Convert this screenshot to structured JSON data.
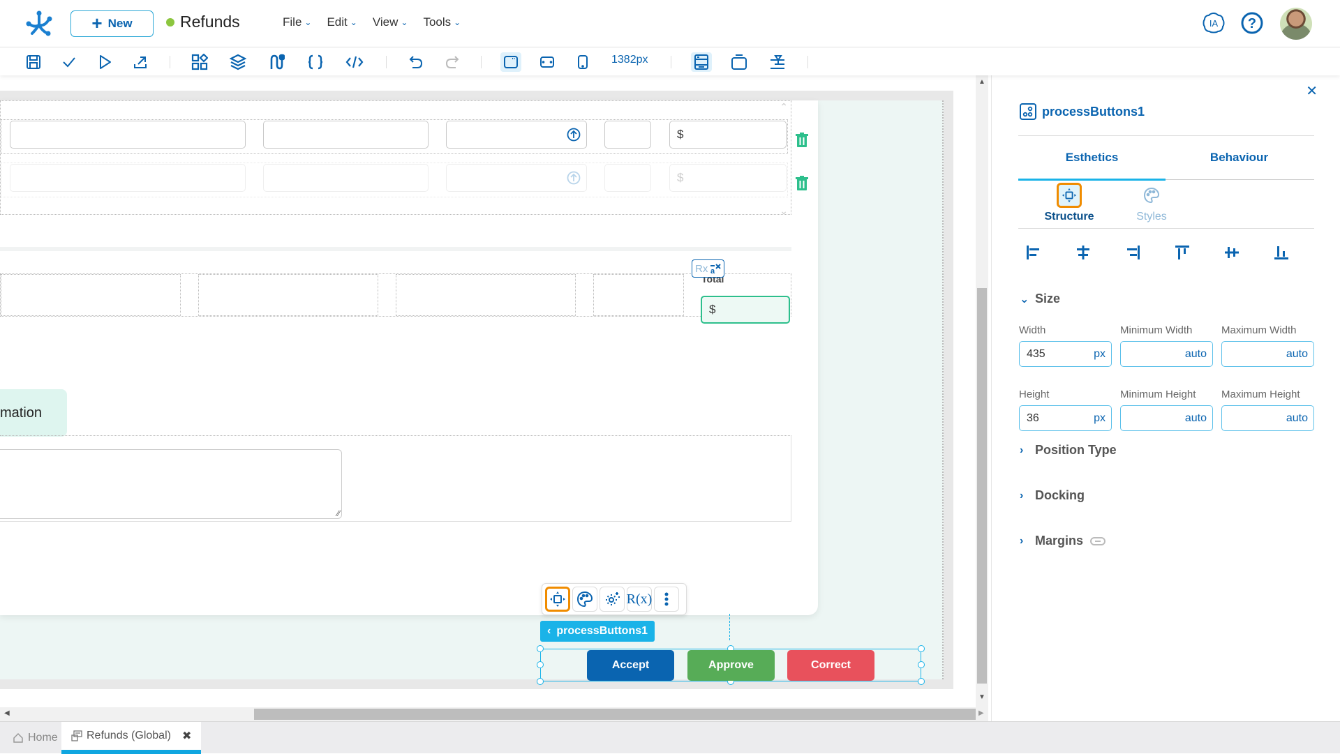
{
  "header": {
    "new_label": "New",
    "app_title": "Refunds",
    "status_color": "#8cc63f",
    "menus": [
      {
        "label": "File"
      },
      {
        "label": "Edit"
      },
      {
        "label": "View"
      },
      {
        "label": "Tools"
      }
    ],
    "ia_label": "IA"
  },
  "toolbar": {
    "icons": [
      "save-icon",
      "check-icon",
      "play-icon",
      "export-icon",
      "components-icon",
      "layers-icon",
      "flows-icon",
      "braces-icon",
      "code-icon",
      "undo-icon",
      "redo-icon",
      "desktop-view-icon",
      "tablet-view-icon",
      "mobile-view-icon",
      "layout-icon",
      "container-icon",
      "dock-icon"
    ],
    "width_readout": "1382px"
  },
  "canvas": {
    "currency_symbol": "$",
    "total_label": "Total",
    "total_value": "$",
    "section_label": "mation",
    "rx_badge": "Rx",
    "floating_toolbar": [
      "structure-icon",
      "palette-icon",
      "settings-icon",
      "rx-icon",
      "more-icon"
    ],
    "rx_glyph": "R(x)",
    "selected_component": "processButtons1",
    "process_buttons": [
      {
        "label": "Accept",
        "color": "#0a64b0"
      },
      {
        "label": "Approve",
        "color": "#57ac57"
      },
      {
        "label": "Correct",
        "color": "#e8515c"
      }
    ]
  },
  "panel": {
    "title": "processButtons1",
    "tabs": [
      {
        "label": "Esthetics"
      },
      {
        "label": "Behaviour"
      }
    ],
    "subtabs": [
      {
        "label": "Structure"
      },
      {
        "label": "Styles"
      }
    ],
    "size_section": "Size",
    "fields": {
      "width_label": "Width",
      "width_value": "435",
      "width_unit": "px",
      "min_width_label": "Minimum Width",
      "min_width_value": "auto",
      "max_width_label": "Maximum Width",
      "max_width_value": "auto",
      "height_label": "Height",
      "height_value": "36",
      "height_unit": "px",
      "min_height_label": "Minimum Height",
      "min_height_value": "auto",
      "max_height_label": "Maximum Height",
      "max_height_value": "auto"
    },
    "collapsed_sections": [
      {
        "label": "Position Type"
      },
      {
        "label": "Docking"
      },
      {
        "label": "Margins"
      }
    ],
    "accent_color": "#f08c00"
  },
  "bottom_tabs": [
    {
      "label": "Home"
    },
    {
      "label": "Refunds (Global)"
    }
  ]
}
